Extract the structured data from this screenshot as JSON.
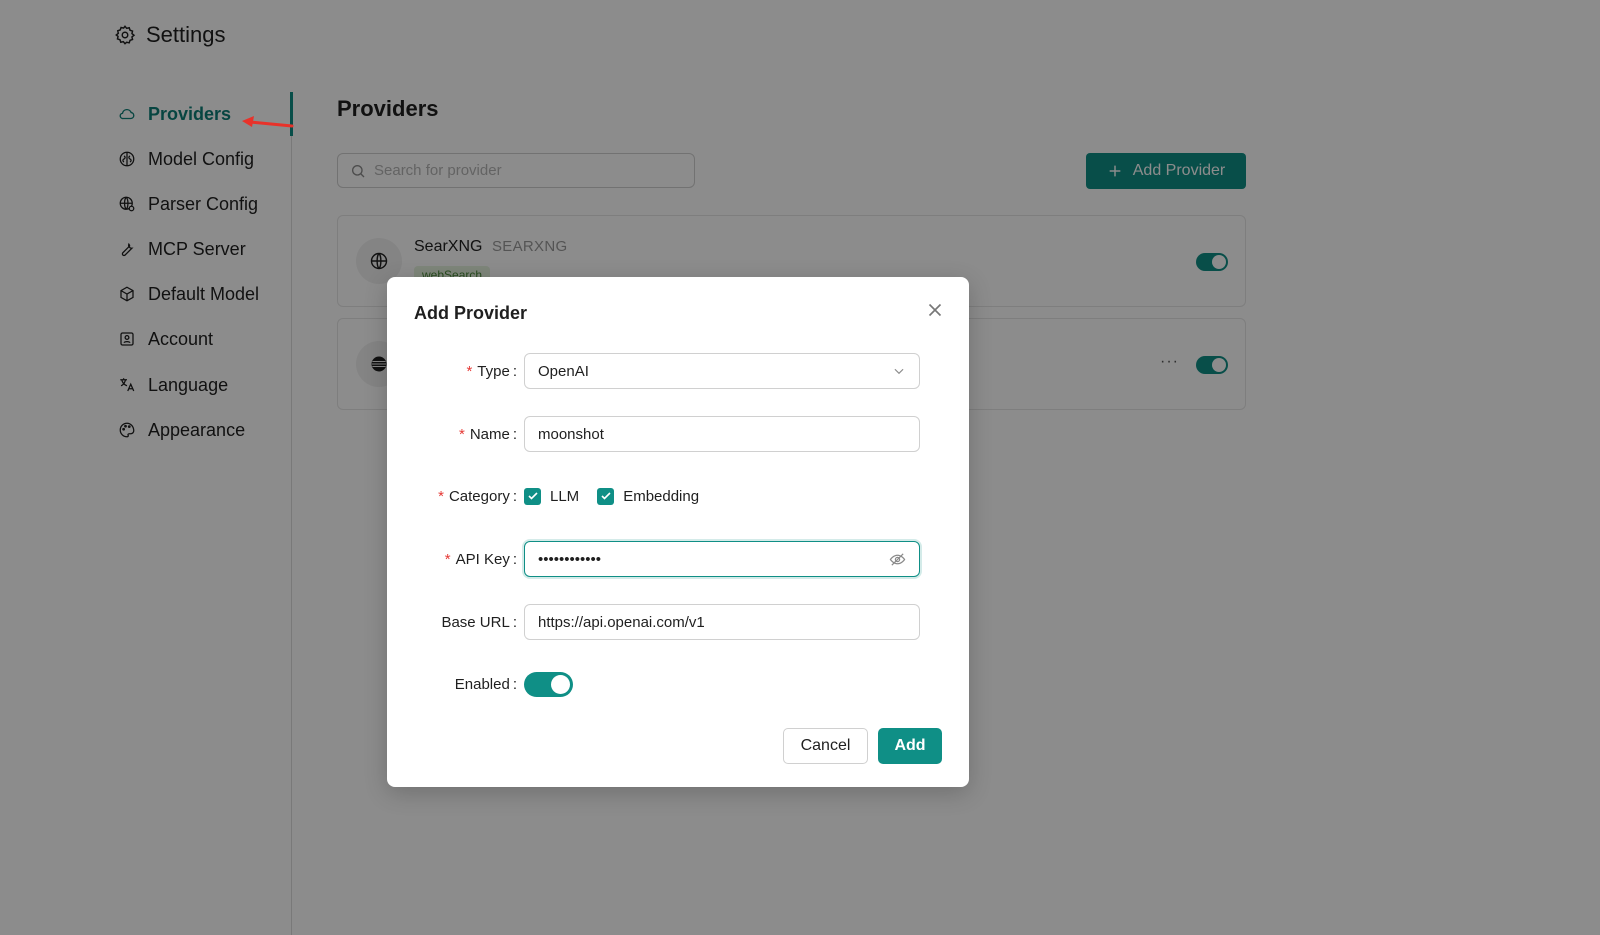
{
  "header": {
    "title": "Settings",
    "icon": "gear-icon"
  },
  "sidebar": {
    "items": [
      {
        "label": "Providers",
        "icon": "cloud-icon",
        "active": true
      },
      {
        "label": "Model Config",
        "icon": "brain-icon"
      },
      {
        "label": "Parser Config",
        "icon": "globe-gear-icon"
      },
      {
        "label": "MCP Server",
        "icon": "wrench-icon"
      },
      {
        "label": "Default Model",
        "icon": "cube-icon"
      },
      {
        "label": "Account",
        "icon": "user-card-icon"
      },
      {
        "label": "Language",
        "icon": "translate-icon"
      },
      {
        "label": "Appearance",
        "icon": "palette-icon"
      }
    ]
  },
  "main": {
    "title": "Providers",
    "search": {
      "placeholder": "Search for provider"
    },
    "add_button": "Add Provider",
    "providers": [
      {
        "name": "SearXNG",
        "type": "SEARXNG",
        "tag": "webSearch",
        "enabled": true
      },
      {
        "name": "",
        "type": "",
        "tag": "",
        "enabled": true,
        "more": "···"
      }
    ]
  },
  "modal": {
    "title": "Add Provider",
    "fields": {
      "type": {
        "label": "Type",
        "required": true,
        "value": "OpenAI"
      },
      "name": {
        "label": "Name",
        "required": true,
        "value": "moonshot"
      },
      "category": {
        "label": "Category",
        "required": true,
        "options": [
          {
            "label": "LLM",
            "checked": true
          },
          {
            "label": "Embedding",
            "checked": true
          }
        ]
      },
      "api_key": {
        "label": "API Key",
        "required": true,
        "value": "••••••••••••"
      },
      "base_url": {
        "label": "Base URL",
        "required": false,
        "value": "https://api.openai.com/v1"
      },
      "enabled": {
        "label": "Enabled",
        "required": false,
        "value": true
      }
    },
    "cancel_label": "Cancel",
    "submit_label": "Add"
  },
  "colors": {
    "accent": "#0f8f86",
    "required": "#e53935",
    "annotation_arrow": "#e8322a"
  }
}
